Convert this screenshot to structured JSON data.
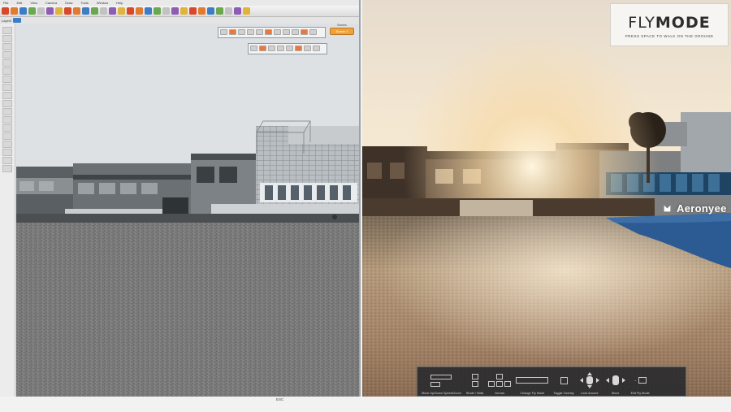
{
  "left_app": {
    "menu_items": [
      "File",
      "Edit",
      "View",
      "Camera",
      "Draw",
      "Tools",
      "Window",
      "Help"
    ],
    "toolbar_icons": [
      "select-icon",
      "eraser-icon",
      "pencil-icon",
      "line-icon",
      "arc-icon",
      "rectangle-icon",
      "push-pull-icon",
      "move-icon",
      "rotate-icon",
      "scale-icon",
      "offset-icon",
      "tape-measure-icon",
      "text-icon",
      "paint-bucket-icon",
      "orbit-icon",
      "pan-icon",
      "zoom-icon",
      "zoom-extents-icon",
      "section-icon",
      "render-icon",
      "camera-icon",
      "walk-icon",
      "look-around-icon",
      "position-camera-icon",
      "styles-icon",
      "shadows-icon",
      "fog-icon",
      "layers-icon"
    ],
    "toolbar2_label": "Layer0",
    "scene_pill_label": "Scene 1",
    "scene_pill_top": "Scenes"
  },
  "right_render": {
    "flymode_title_thin": "FLY",
    "flymode_title_bold": "MODE",
    "flymode_subtitle": "PRESS SPACE TO WALK ON THE GROUND",
    "brand_name": "Aeronyee"
  },
  "controls": {
    "groups": [
      {
        "caption": "Move Up/Down Speed/Zoom",
        "icon": "mouse-keys-icon"
      },
      {
        "caption": "Strafe / Walk",
        "icon": "wasd-keys-icon"
      },
      {
        "caption": "Arrows",
        "icon": "arrow-keys-icon"
      },
      {
        "caption": "Change Fly Mode",
        "icon": "space-bar-icon"
      },
      {
        "caption": "Toggle Overlay",
        "icon": "h-key-icon"
      },
      {
        "caption": "Look Around",
        "icon": "mouse-look-icon"
      },
      {
        "caption": "Move",
        "icon": "mouse-move-icon"
      },
      {
        "caption": "Exit Fly Mode",
        "icon": "escape-key-icon"
      }
    ]
  },
  "bottom_caption": "ESC",
  "colors": {
    "toolbar_accent": "#d9482b",
    "scene_pill": "#f0a13a",
    "sky_left": "#dfe3e6",
    "sky_right_warm": "#f3e4cc",
    "water": "#2c5a92"
  }
}
